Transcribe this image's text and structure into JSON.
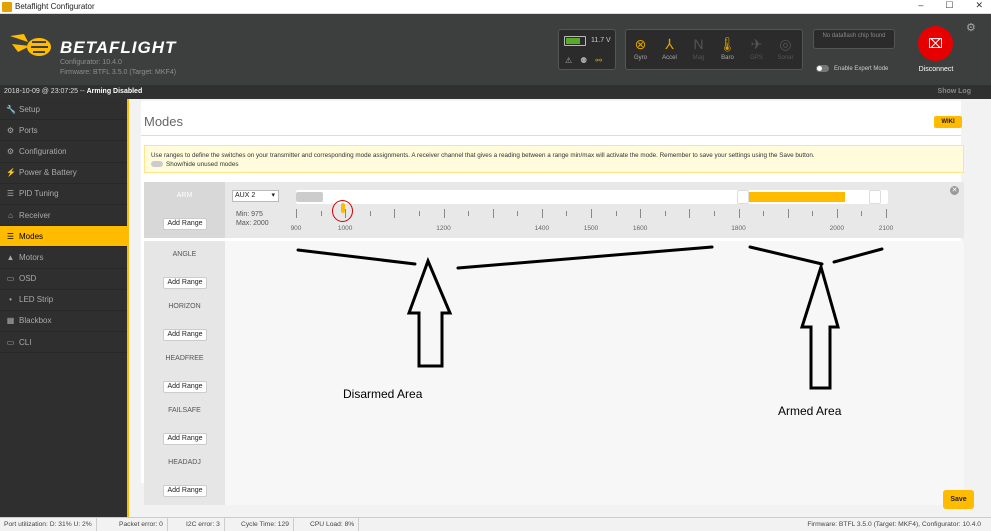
{
  "window": {
    "title": "Betaflight Configurator",
    "controls": [
      "–",
      "☐",
      "✕"
    ]
  },
  "header": {
    "logo": "BETAFLIGHT",
    "configurator": "Configurator: 10.4.0",
    "firmware": "Firmware: BTFL 3.5.0 (Target: MKF4)",
    "battery_voltage": "11.7 V",
    "sensors": [
      {
        "label": "Gyro",
        "icon": "⊗",
        "on": true
      },
      {
        "label": "Accel",
        "icon": "⅄",
        "on": true
      },
      {
        "label": "Mag",
        "icon": "N",
        "on": false
      },
      {
        "label": "Baro",
        "icon": "🌡",
        "on": true
      },
      {
        "label": "GPS",
        "icon": "✈",
        "on": false
      },
      {
        "label": "Sonar",
        "icon": "◎",
        "on": false
      }
    ],
    "dataflash": "No dataflash chip found",
    "expert_mode": "Enable Expert Mode",
    "disconnect": "Disconnect"
  },
  "status": {
    "text": "2018-10-09 @ 23:07:25 -- ",
    "bold": "Arming Disabled",
    "show_log": "Show Log"
  },
  "nav": [
    {
      "label": "Setup",
      "icon": "🔧"
    },
    {
      "label": "Ports",
      "icon": "⚙"
    },
    {
      "label": "Configuration",
      "icon": "⚙"
    },
    {
      "label": "Power & Battery",
      "icon": "⚡"
    },
    {
      "label": "PID Tuning",
      "icon": "☰"
    },
    {
      "label": "Receiver",
      "icon": "⌂"
    },
    {
      "label": "Modes",
      "icon": "☰",
      "active": true
    },
    {
      "label": "Motors",
      "icon": "▲"
    },
    {
      "label": "OSD",
      "icon": "▭"
    },
    {
      "label": "LED Strip",
      "icon": "•"
    },
    {
      "label": "Blackbox",
      "icon": "▦"
    },
    {
      "label": "CLI",
      "icon": "▭"
    }
  ],
  "page": {
    "title": "Modes",
    "wiki": "WIKI",
    "note": "Use ranges to define the switches on your transmitter and corresponding mode assignments. A receiver channel that gives a reading between a range min/max will activate the mode. Remember to save your settings using the Save button.",
    "show_unused": "Show/hide unused modes",
    "add_range": "Add Range",
    "save": "Save"
  },
  "modes": [
    {
      "name": "ARM",
      "aux": "AUX 2",
      "min": "Min: 975",
      "max": "Max: 2000"
    },
    {
      "name": "ANGLE"
    },
    {
      "name": "HORIZON"
    },
    {
      "name": "HEADFREE"
    },
    {
      "name": "FAILSAFE"
    },
    {
      "name": "HEADADJ"
    }
  ],
  "range": {
    "scale_min": 900,
    "scale_max": 2100,
    "range_min": 1800,
    "range_max": 2100,
    "current": 1000,
    "ticks": [
      "900",
      "1000",
      "1200",
      "1400",
      "1500",
      "1600",
      "1800",
      "2000",
      "2100"
    ]
  },
  "footer": {
    "port": "Port utilization: D: 31% U: 2%",
    "packet": "Packet error: 0",
    "i2c": "I2C error: 3",
    "cycle": "Cycle Time: 129",
    "cpu": "CPU Load: 8%",
    "firmware": "Firmware: BTFL 3.5.0 (Target: MKF4), Configurator: 10.4.0"
  },
  "annotations": {
    "disarmed": "Disarmed Area",
    "armed": "Armed Area"
  }
}
